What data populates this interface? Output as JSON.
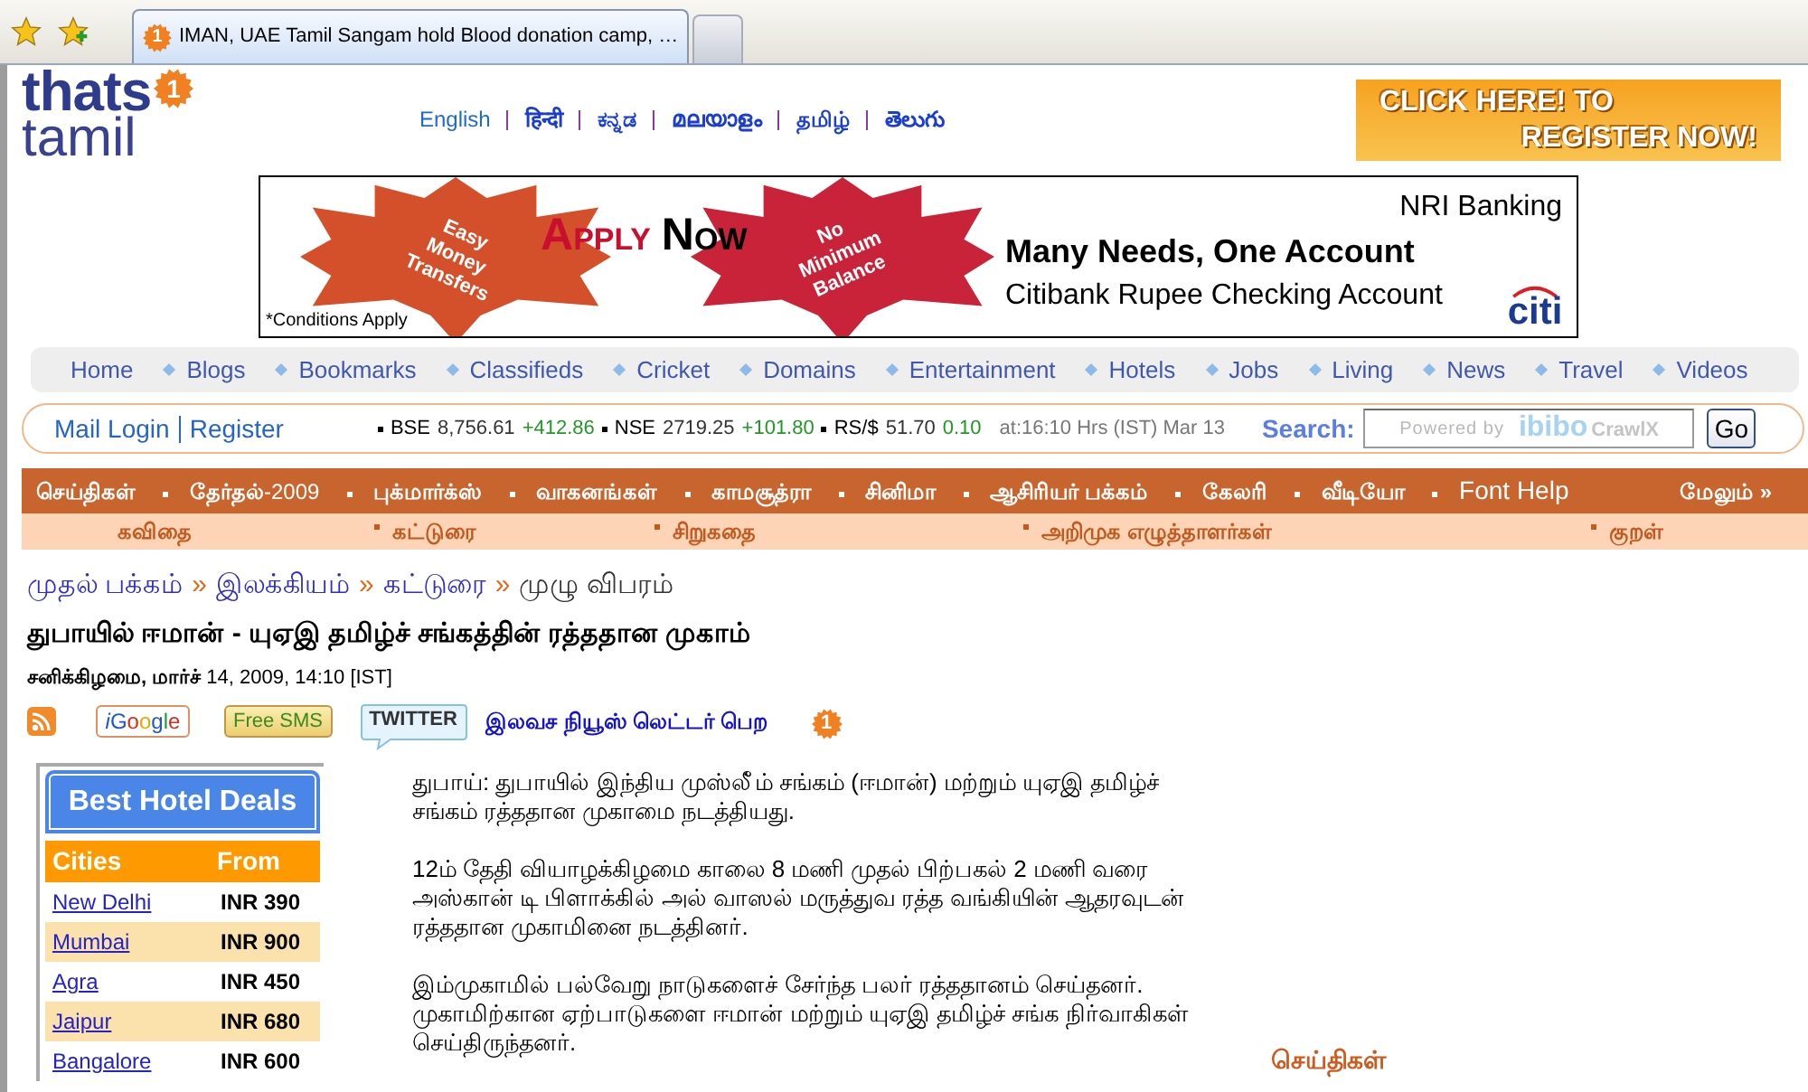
{
  "browser": {
    "tabs": [
      {
        "title": "IMAN, UAE Tamil Sangam hold Blood donation camp, …",
        "badge": "1",
        "selected": true
      },
      {
        "selected": false
      }
    ]
  },
  "header": {
    "logo": {
      "line1": "thats",
      "line2": "tamil",
      "badge": "1"
    },
    "languages": [
      "English",
      "हिन्दी",
      "ಕನ್ನಡ",
      "മലയാളം",
      "தமிழ்",
      "తెలుగు"
    ],
    "register_banner": {
      "line1": "CLICK HERE! TO",
      "line2": "REGISTER NOW!"
    }
  },
  "ad": {
    "leaf_left": [
      "Easy",
      "Money",
      "Transfers"
    ],
    "apply": "APPLY",
    "now": "NOW",
    "leaf_right": [
      "No",
      "Minimum",
      "Balance"
    ],
    "tagline": "NRI Banking",
    "headline": "Many Needs, One Account",
    "subline": "Citibank Rupee Checking Account",
    "note": "*Conditions Apply",
    "logo": "citi"
  },
  "top_nav": [
    "Home",
    "Blogs",
    "Bookmarks",
    "Classifieds",
    "Cricket",
    "Domains",
    "Entertainment",
    "Hotels",
    "Jobs",
    "Living",
    "News",
    "Travel",
    "Videos"
  ],
  "account_bar": {
    "mail_login": "Mail Login",
    "register": "Register",
    "ticker": [
      {
        "name": "BSE",
        "value": "8,756.61",
        "change": "+412.86"
      },
      {
        "name": "NSE",
        "value": "2719.25",
        "change": "+101.80"
      },
      {
        "name": "RS/$",
        "value": "51.70",
        "change": "0.10"
      }
    ],
    "updated": "at:16:10 Hrs (IST) Mar 13",
    "search": {
      "label": "Search:",
      "hint": "Powered by",
      "brand": "ibibo",
      "brand_suffix": "CrawlX",
      "button": "Go"
    }
  },
  "section_nav": {
    "items": [
      {
        "label": "செய்திகள்",
        "kind": "bold"
      },
      {
        "label": "**தேர்தல்**-2009",
        "kind": "mixed"
      },
      {
        "label": "புக்மார்க்ஸ்",
        "kind": "bold"
      },
      {
        "label": "வாகனங்கள்",
        "kind": "bold"
      },
      {
        "label": "காமசூத்ரா",
        "kind": "bold"
      },
      {
        "label": "சினிமா",
        "kind": "bold"
      },
      {
        "label": "ஆசிரியர் பக்கம்",
        "kind": "bold"
      },
      {
        "label": "கேலரி",
        "kind": "bold"
      },
      {
        "label": "வீடியோ",
        "kind": "bold"
      },
      {
        "label": "Font Help",
        "kind": "plain"
      }
    ],
    "more": "மேலும் »"
  },
  "sub_nav": [
    "கவிதை",
    "கட்டுரை",
    "சிறுகதை",
    "அறிமுக எழுத்தாளர்கள்",
    "குறள்"
  ],
  "article": {
    "breadcrumb": [
      {
        "label": "முதல் பக்கம்",
        "kind": "link"
      },
      {
        "label": "»",
        "kind": "separator"
      },
      {
        "label": "இலக்கியம்",
        "kind": "link"
      },
      {
        "label": "»",
        "kind": "separator"
      },
      {
        "label": "கட்டுரை",
        "kind": "link"
      },
      {
        "label": "»",
        "kind": "separator"
      },
      {
        "label": "முழு விபரம்",
        "kind": "current"
      }
    ],
    "title": "துபாயில் ஈமான் - யுஏஇ தமிழ்ச் சங்கத்தின் ரத்ததான முகாம்",
    "date": "**சனிக்கிழமை, மார்ச்** 14, 2009, 14:10 [IST]",
    "share": {
      "igoogle": "iGoogle",
      "sms": "Free SMS",
      "twitter": "TWITTER",
      "newsletter": "இலவச நியூஸ் லெட்டர் பெற",
      "badge": "1"
    },
    "paragraphs": [
      "துபாய்: துபாயில் இந்திய முஸ்லீ்ம் சங்கம் (ஈமான்) மற்றும் யுஏஇ தமிழ்ச் சங்கம் ரத்ததான முகாமை நடத்தியது.",
      "12ம் தேதி வியாழக்கிழமை காலை 8 மணி முதல் பிற்பகல் 2 மணி வரை அஸ்கான் டி பிளாக்கில் அல் வாஸல் மருத்துவ ரத்த வங்கியின் ஆதரவுடன் ரத்ததான முகாமினை நடத்தினர்.",
      "இம்முகாமில் பல்வேறு நாடுகளைச் சேர்ந்த பலர் ரத்ததானம் செய்தனர். முகாமிற்கான ஏற்பாடுகளை ஈமான் மற்றும் யுஏஇ தமிழ்ச் சங்க நிர்வாகிகள் செய்திருந்தனர்."
    ]
  },
  "hotel_deals": {
    "title": "Best Hotel Deals",
    "columns": [
      "Cities",
      "From"
    ],
    "rows": [
      {
        "city": "New Delhi",
        "price": "INR 390"
      },
      {
        "city": "Mumbai",
        "price": "INR 900"
      },
      {
        "city": "Agra",
        "price": "INR 450"
      },
      {
        "city": "Jaipur",
        "price": "INR 680"
      },
      {
        "city": "Bangalore",
        "price": "INR 600"
      }
    ]
  },
  "side_box": {
    "title": "செய்திகள்"
  }
}
